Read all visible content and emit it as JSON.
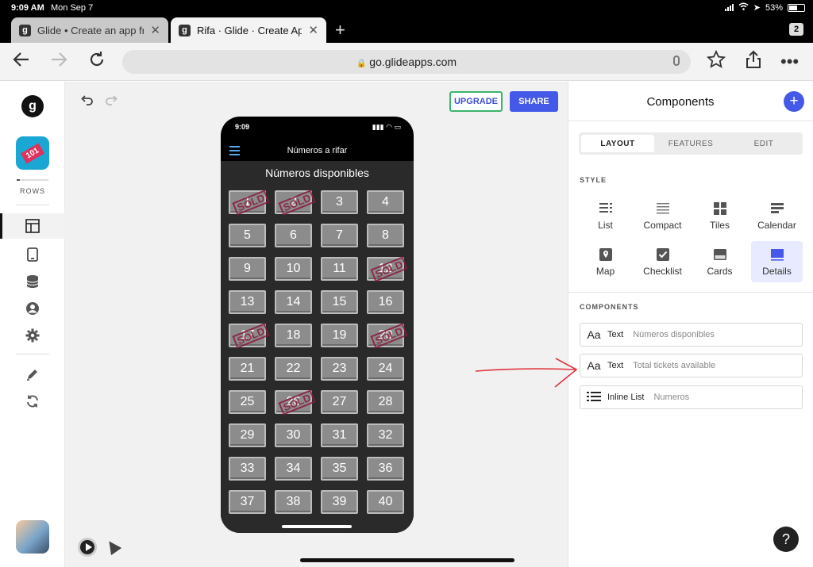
{
  "status": {
    "time": "9:09 AM",
    "date": "Mon Sep 7",
    "battery": "53%"
  },
  "tabs": [
    {
      "label": "Glide • Create an app fro"
    },
    {
      "label": "Rifa · Glide · Create Apps"
    }
  ],
  "tab_count": "2",
  "address": {
    "url": "go.glideapps.com"
  },
  "sidebar": {
    "logo": "g",
    "app_icon_text": "101",
    "rows_label": "ROWS"
  },
  "canvas": {
    "upgrade_label": "UPGRADE",
    "share_label": "SHARE"
  },
  "phone": {
    "time": "9:09",
    "title": "Números a rifar",
    "heading": "Números disponibles",
    "sold_stamp": "SOLD",
    "tickets": [
      {
        "n": "1",
        "sold": true
      },
      {
        "n": "2",
        "sold": true
      },
      {
        "n": "3",
        "sold": false
      },
      {
        "n": "4",
        "sold": false
      },
      {
        "n": "5",
        "sold": false
      },
      {
        "n": "6",
        "sold": false
      },
      {
        "n": "7",
        "sold": false
      },
      {
        "n": "8",
        "sold": false
      },
      {
        "n": "9",
        "sold": false
      },
      {
        "n": "10",
        "sold": false
      },
      {
        "n": "11",
        "sold": false
      },
      {
        "n": "12",
        "sold": true
      },
      {
        "n": "13",
        "sold": false
      },
      {
        "n": "14",
        "sold": false
      },
      {
        "n": "15",
        "sold": false
      },
      {
        "n": "16",
        "sold": false
      },
      {
        "n": "17",
        "sold": true
      },
      {
        "n": "18",
        "sold": false
      },
      {
        "n": "19",
        "sold": false
      },
      {
        "n": "20",
        "sold": true
      },
      {
        "n": "21",
        "sold": false
      },
      {
        "n": "22",
        "sold": false
      },
      {
        "n": "23",
        "sold": false
      },
      {
        "n": "24",
        "sold": false
      },
      {
        "n": "25",
        "sold": false
      },
      {
        "n": "26",
        "sold": true
      },
      {
        "n": "27",
        "sold": false
      },
      {
        "n": "28",
        "sold": false
      },
      {
        "n": "29",
        "sold": false
      },
      {
        "n": "30",
        "sold": false
      },
      {
        "n": "31",
        "sold": false
      },
      {
        "n": "32",
        "sold": false
      },
      {
        "n": "33",
        "sold": false
      },
      {
        "n": "34",
        "sold": false
      },
      {
        "n": "35",
        "sold": false
      },
      {
        "n": "36",
        "sold": false
      },
      {
        "n": "37",
        "sold": false
      },
      {
        "n": "38",
        "sold": false
      },
      {
        "n": "39",
        "sold": false
      },
      {
        "n": "40",
        "sold": false
      }
    ]
  },
  "panel": {
    "title": "Components",
    "tabs": [
      "LAYOUT",
      "FEATURES",
      "EDIT"
    ],
    "style_label": "STYLE",
    "styles": [
      {
        "label": "List",
        "icon": "list-icon"
      },
      {
        "label": "Compact",
        "icon": "compact-icon"
      },
      {
        "label": "Tiles",
        "icon": "tiles-icon"
      },
      {
        "label": "Calendar",
        "icon": "calendar-icon"
      },
      {
        "label": "Map",
        "icon": "map-icon"
      },
      {
        "label": "Checklist",
        "icon": "checklist-icon"
      },
      {
        "label": "Cards",
        "icon": "cards-icon"
      },
      {
        "label": "Details",
        "icon": "details-icon"
      }
    ],
    "components_label": "COMPONENTS",
    "components": [
      {
        "icon_text": "Aa",
        "name": "Text",
        "value": "Números disponibles"
      },
      {
        "icon_text": "Aa",
        "name": "Text",
        "value": "Total tickets available"
      },
      {
        "icon_text": "",
        "name": "Inline List",
        "value": "Numeros"
      }
    ],
    "help": "?"
  },
  "colors": {
    "accent": "#4459e8",
    "sold_stamp": "#8a1a3c",
    "annotation_arrow": "#e0323c"
  }
}
